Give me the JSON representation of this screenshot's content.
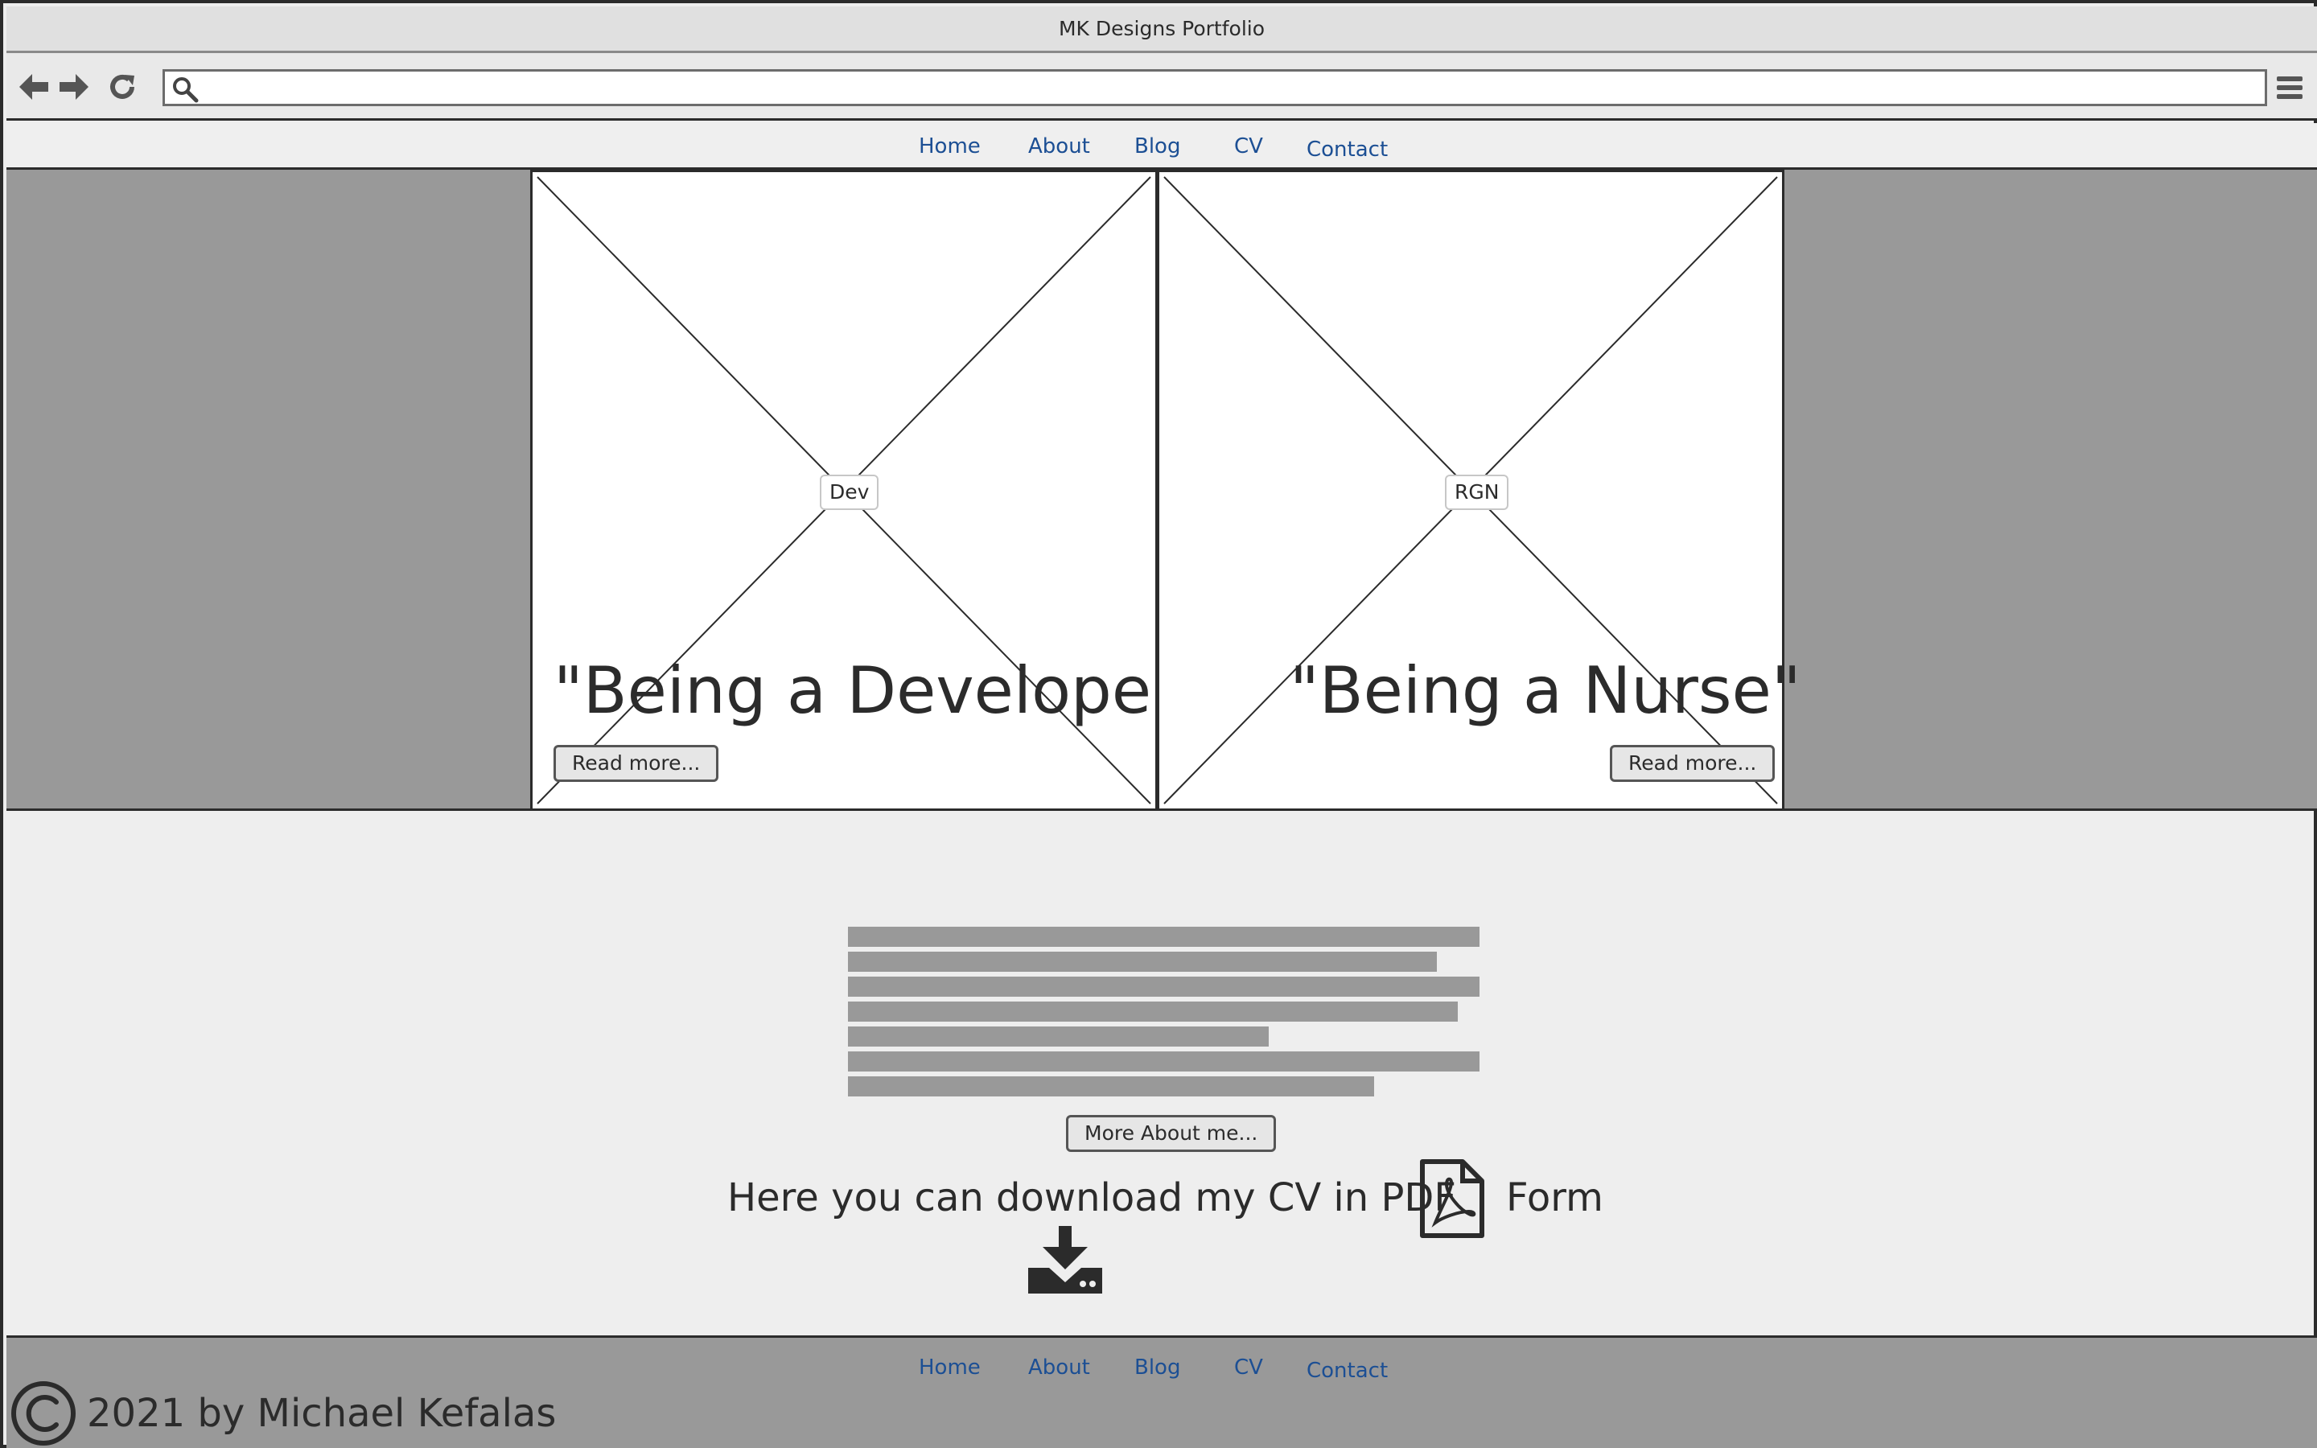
{
  "window": {
    "title": "MK Designs Portfolio"
  },
  "browser": {
    "back_icon": "arrow-left-icon",
    "forward_icon": "arrow-right-icon",
    "reload_icon": "reload-icon",
    "search_icon": "search-icon",
    "menu_icon": "hamburger-menu-icon",
    "address_value": ""
  },
  "nav": {
    "home": "Home",
    "about": "About",
    "blog": "Blog",
    "cv": "CV",
    "contact": "Contact"
  },
  "hero": {
    "cards": [
      {
        "tag": "Dev",
        "title": "\"Being a Developer\"",
        "button": "Read more..."
      },
      {
        "tag": "RGN",
        "title": "\"Being a Nurse\"",
        "button": "Read more..."
      }
    ]
  },
  "about": {
    "button": "More About me...",
    "placeholder_lines": 7
  },
  "cv": {
    "text": "Here you can  download my CV in PDF",
    "form_label": "Form",
    "pdf_icon": "pdf-file-icon",
    "download_icon": "download-icon"
  },
  "footer": {
    "copyright": "2021 by Michael Kefalas",
    "nav": {
      "home": "Home",
      "about": "About",
      "blog": "Blog",
      "cv": "CV",
      "contact": "Contact"
    }
  },
  "colors": {
    "link": "#1c4f94",
    "hero_bg": "#999999",
    "page_bg": "#eeeeee",
    "ink": "#2b2b2b"
  }
}
